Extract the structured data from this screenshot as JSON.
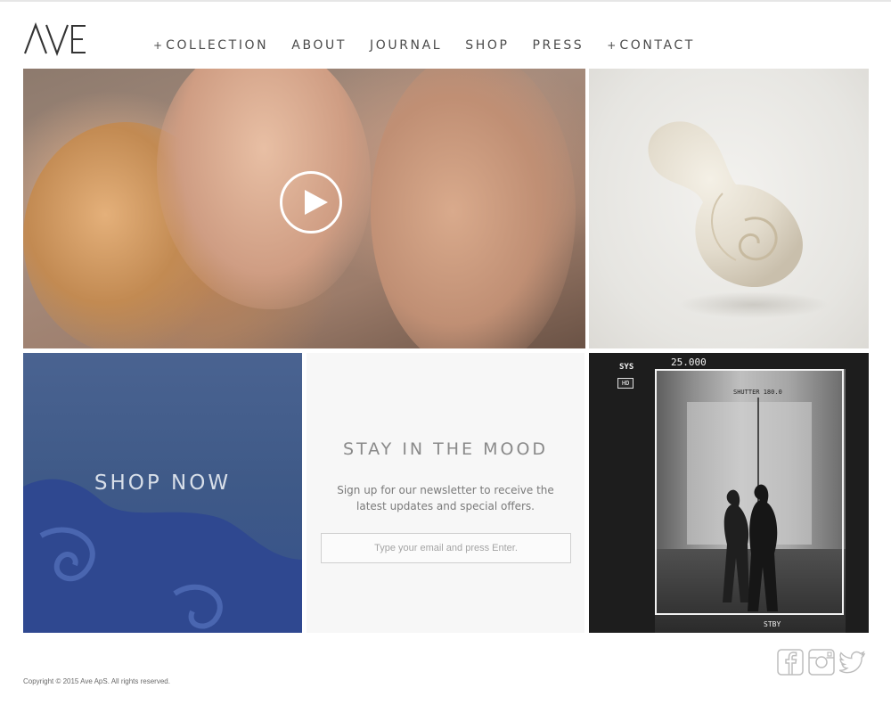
{
  "brand": {
    "logo_text": "AVE"
  },
  "nav": {
    "items": [
      {
        "label": "COLLECTION",
        "prefix": "+"
      },
      {
        "label": "ABOUT",
        "prefix": ""
      },
      {
        "label": "JOURNAL",
        "prefix": ""
      },
      {
        "label": "SHOP",
        "prefix": ""
      },
      {
        "label": "PRESS",
        "prefix": ""
      },
      {
        "label": "CONTACT",
        "prefix": "+"
      }
    ]
  },
  "tiles": {
    "video": {
      "icon": "play-icon"
    },
    "shop": {
      "label": "SHOP NOW"
    },
    "newsletter": {
      "title": "STAY IN THE MOOD",
      "text": "Sign up for our newsletter to receive the latest updates and special offers.",
      "input_placeholder": "Type your email and press Enter."
    },
    "camera": {
      "iso": "25.000",
      "mode": "SYS",
      "mode_sub": "HD",
      "shutter": "SHUTTER 180.0",
      "status": "STBY"
    }
  },
  "footer": {
    "copyright": "Copyright © 2015 Ave ApS. All rights reserved.",
    "social_icons": [
      "facebook-icon",
      "instagram-icon",
      "twitter-icon"
    ]
  },
  "colors": {
    "text": "#4a4a4a",
    "shop_blue": "#3f5a88",
    "newsletter_bg": "#f7f7f7",
    "social_gray": "#bdbdbd"
  }
}
